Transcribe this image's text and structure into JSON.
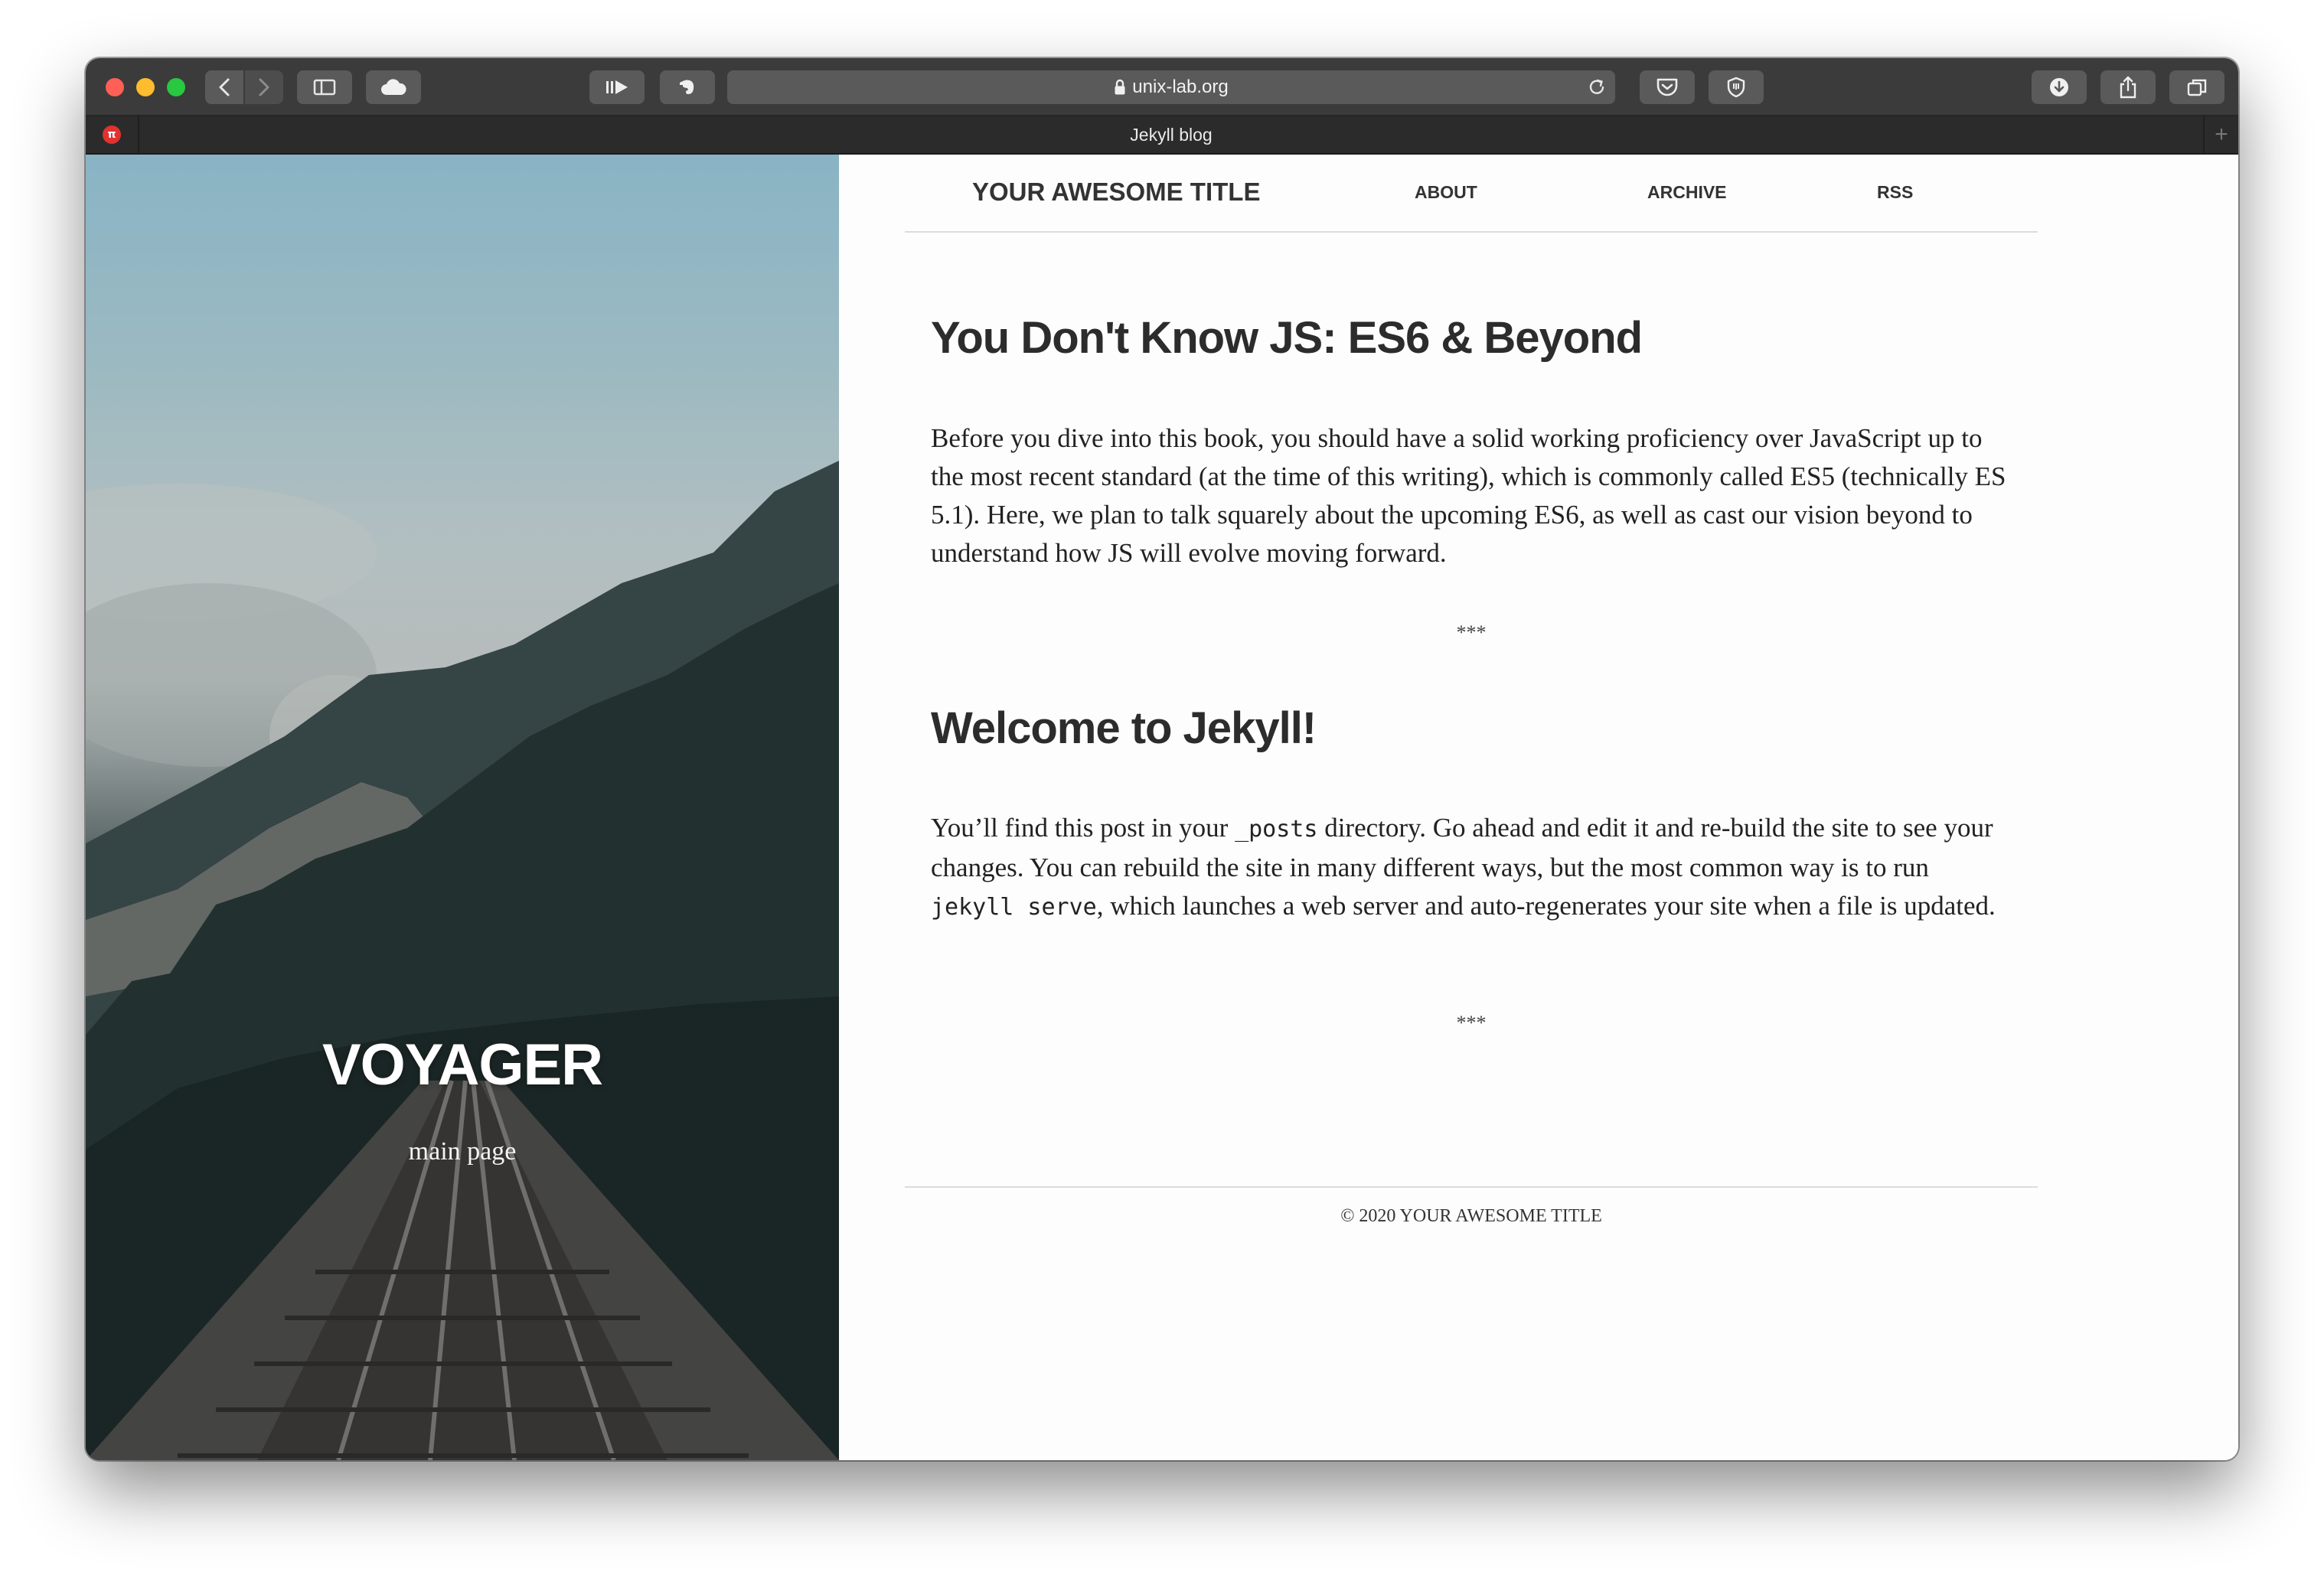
{
  "browser": {
    "url": "unix-lab.org",
    "tab_title": "Jekyll blog",
    "favicon_letter": "π",
    "new_tab_label": "+"
  },
  "hero": {
    "title": "VOYAGER",
    "subtitle": "main page"
  },
  "nav": {
    "site_title": "YOUR AWESOME TITLE",
    "links": [
      "ABOUT",
      "ARCHIVE",
      "RSS"
    ]
  },
  "posts": [
    {
      "title": "You Don't Know JS: ES6 & Beyond",
      "body": "Before you dive into this book, you should have a solid working proficiency over JavaScript up to the most recent standard (at the time of this writing), which is commonly called ES5 (technically ES 5.1). Here, we plan to talk squarely about the upcoming ES6, as well as cast our vision beyond to understand how JS will evolve moving forward."
    },
    {
      "title": "Welcome to Jekyll!",
      "body_parts": [
        "You’ll find this post in your ",
        "_posts",
        " directory. Go ahead and edit it and re-build the site to see your changes. You can rebuild the site in many different ways, but the most common way is to run ",
        "jekyll serve",
        ", which launches a web server and auto-regenerates your site when a file is updated."
      ]
    }
  ],
  "separator": "***",
  "footer": "© 2020 YOUR AWESOME TITLE",
  "colors": {
    "titlebar": "#3b3b3b",
    "tabbar": "#2b2b2b",
    "close": "#fe5f57",
    "minimize": "#febc2e",
    "maximize": "#28c840",
    "text": "#2c2c2c"
  },
  "icons": [
    "back-icon",
    "forward-icon",
    "sidebar-icon",
    "cloud-icon",
    "reader-play-icon",
    "evernote-icon",
    "reader-list-icon",
    "lock-icon",
    "reload-icon",
    "pocket-icon",
    "shield-icon",
    "download-icon",
    "share-icon",
    "tabs-icon"
  ]
}
